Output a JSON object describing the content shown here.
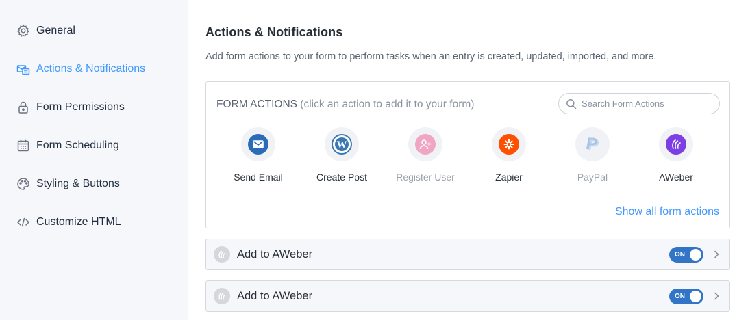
{
  "sidebar": {
    "items": [
      {
        "label": "General",
        "icon": "gear-icon",
        "active": false
      },
      {
        "label": "Actions & Notifications",
        "icon": "actions-icon",
        "active": true
      },
      {
        "label": "Form Permissions",
        "icon": "lock-icon",
        "active": false
      },
      {
        "label": "Form Scheduling",
        "icon": "calendar-icon",
        "active": false
      },
      {
        "label": "Styling & Buttons",
        "icon": "palette-icon",
        "active": false
      },
      {
        "label": "Customize HTML",
        "icon": "code-icon",
        "active": false
      }
    ]
  },
  "main": {
    "title": "Actions & Notifications",
    "description": "Add form actions to your form to perform tasks when an entry is created, updated, imported, and more.",
    "form_actions": {
      "heading": "FORM ACTIONS",
      "hint": "(click an action to add it to your form)",
      "search_placeholder": "Search Form Actions",
      "actions": [
        {
          "label": "Send Email",
          "icon": "email-icon",
          "color": "#2b6cb8",
          "disabled": false
        },
        {
          "label": "Create Post",
          "icon": "wordpress-icon",
          "color": "#3a78b3",
          "disabled": false
        },
        {
          "label": "Register User",
          "icon": "user-add-icon",
          "color": "#f0a5c3",
          "disabled": true
        },
        {
          "label": "Zapier",
          "icon": "zapier-icon",
          "color": "#ff4f00",
          "disabled": false
        },
        {
          "label": "PayPal",
          "icon": "paypal-icon",
          "color": "#a9c4e8",
          "disabled": true
        },
        {
          "label": "AWeber",
          "icon": "aweber-icon",
          "color": "#7b3fe4",
          "disabled": false
        }
      ],
      "show_all_label": "Show all form actions"
    },
    "rows": [
      {
        "label": "Add to AWeber",
        "toggle_label": "ON",
        "enabled": true
      },
      {
        "label": "Add to AWeber",
        "toggle_label": "ON",
        "enabled": true
      }
    ]
  },
  "colors": {
    "accent": "#4199fd",
    "toggle_on": "#3275c7"
  }
}
